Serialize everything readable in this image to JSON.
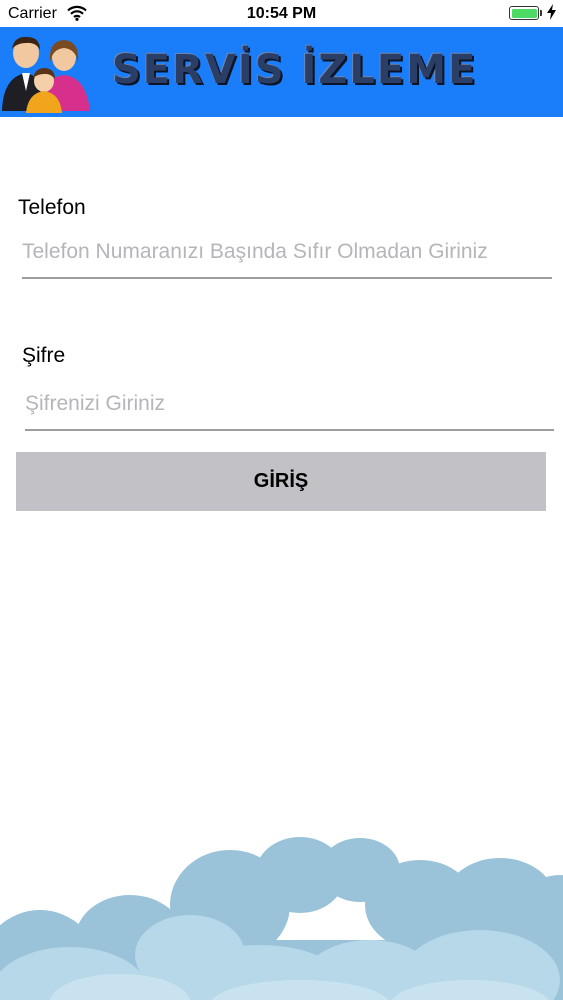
{
  "status_bar": {
    "carrier": "Carrier",
    "time": "10:54 PM",
    "battery_color": "#4cd964"
  },
  "header": {
    "title": "SERVİS İZLEME",
    "background_color": "#1a7efb"
  },
  "form": {
    "phone": {
      "label": "Telefon",
      "value": "",
      "placeholder": "Telefon Numaranızı Başında Sıfır Olmadan Giriniz"
    },
    "password": {
      "label": "Şifre",
      "value": "",
      "placeholder": "Şifrenizi Giriniz"
    },
    "submit_label": "GİRİŞ"
  },
  "icons": {
    "wifi": "wifi-icon",
    "battery": "battery-icon",
    "charging": "charging-bolt-icon",
    "logo": "family-icon",
    "decoration": "clouds-decoration"
  }
}
